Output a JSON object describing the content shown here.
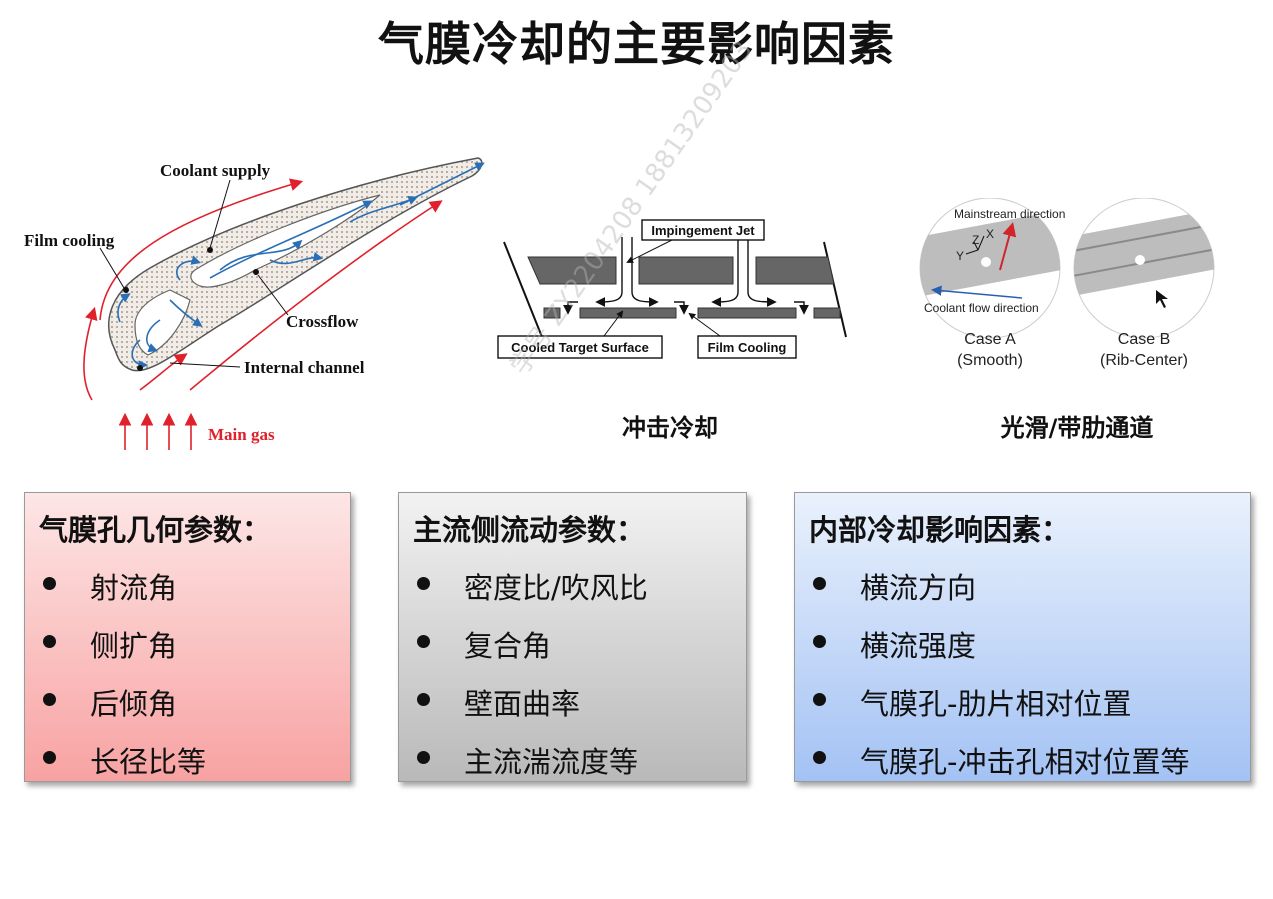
{
  "page": {
    "title": "气膜冷却的主要影响因素"
  },
  "figure_airfoil": {
    "labels": {
      "coolant_supply": "Coolant supply",
      "film_cooling": "Film cooling",
      "crossflow": "Crossflow",
      "internal_channel": "Internal channel",
      "main_gas": "Main gas"
    }
  },
  "figure_impingement": {
    "labels": {
      "impingement_jet": "Impingement Jet",
      "cooled_target_surface": "Cooled Target Surface",
      "film_cooling": "Film Cooling"
    },
    "caption": "冲击冷却"
  },
  "figure_channel": {
    "labels": {
      "mainstream_direction": "Mainstream direction",
      "coolant_flow_direction": "Coolant flow direction",
      "axis_z": "Z",
      "axis_x": "X",
      "axis_y": "Y",
      "case_a": "Case A",
      "case_a_sub": "(Smooth)",
      "case_b": "Case B",
      "case_b_sub": "(Rib-Center)"
    },
    "caption": "光滑/带肋通道"
  },
  "boxes": [
    {
      "heading": "气膜孔几何参数：",
      "items": [
        "射流角",
        "侧扩角",
        "后倾角",
        "长径比等"
      ]
    },
    {
      "heading": "主流侧流动参数：",
      "items": [
        "密度比/吹风比",
        "复合角",
        "壁面曲率",
        "主流湍流度等"
      ]
    },
    {
      "heading": "内部冷却影响因素：",
      "items": [
        "横流方向",
        "横流强度",
        "气膜孔-肋片相对位置",
        "气膜孔-冲击孔相对位置等"
      ]
    }
  ],
  "watermark": "学号 ZY2204208  18813209203",
  "colors": {
    "main_gas": "#e0212b",
    "flow_arrow": "#2a6fb5",
    "box_a": "#f8a2a2",
    "box_b": "#b9b9b9",
    "box_c": "#a3c2f4"
  }
}
